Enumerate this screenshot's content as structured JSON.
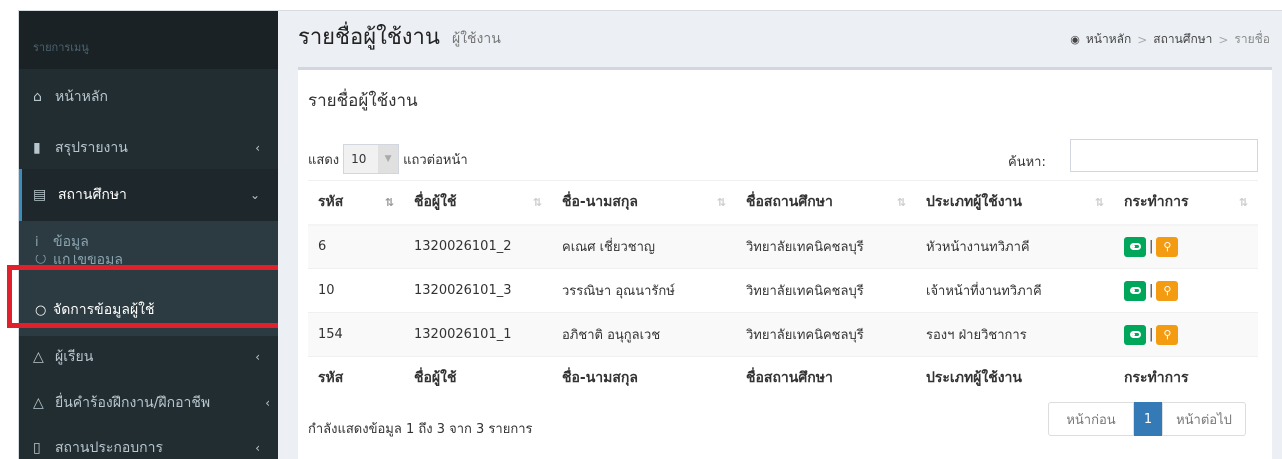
{
  "sidebar": {
    "header": "รายการเมนู",
    "items": [
      {
        "label": "หน้าหลัก",
        "icon": "home-icon"
      },
      {
        "label": "สรุปรายงาน",
        "icon": "book-icon"
      },
      {
        "label": "สถานศึกษา",
        "icon": "institution-icon"
      },
      {
        "label": "ผู้เรียน",
        "icon": "graduation-cap-icon"
      },
      {
        "label": "ยื่นคำร้องฝึกงาน/ฝึกอาชีพ",
        "icon": "graduation-cap-icon"
      },
      {
        "label": "สถานประกอบการ",
        "icon": "building-icon"
      }
    ],
    "sub_items": [
      {
        "label": "ข้อมูล"
      },
      {
        "label": "แก้ไขข้อมูล"
      },
      {
        "label": "จัดการข้อมูลผู้ใช้"
      }
    ]
  },
  "header": {
    "title": "รายชื่อผู้ใช้งาน",
    "subtitle": "ผู้ใช้งาน",
    "breadcrumb": [
      "หน้าหลัก",
      "สถานศึกษา",
      "รายชื่อ"
    ]
  },
  "box": {
    "title": "รายชื่อผู้ใช้งาน",
    "length_prefix": "แสดง",
    "length_value": "10",
    "length_suffix": "แถวต่อหน้า",
    "search_label": "ค้นหา:",
    "search_value": ""
  },
  "table": {
    "columns": [
      "รหัส",
      "ชื่อผู้ใช้",
      "ชื่อ-นามสกุล",
      "ชื่อสถานศึกษา",
      "ประเภทผู้ใช้งาน",
      "กระทำการ"
    ],
    "rows": [
      {
        "id": "6",
        "username": "1320026101_2",
        "fullname": "คเณศ เชี่ยวชาญ",
        "school": "วิทยาลัยเทคนิคชลบุรี",
        "role": "หัวหน้างานทวิภาคี"
      },
      {
        "id": "10",
        "username": "1320026101_3",
        "fullname": "วรรณิษา อุณนารักษ์",
        "school": "วิทยาลัยเทคนิคชลบุรี",
        "role": "เจ้าหน้าที่งานทวิภาคี"
      },
      {
        "id": "154",
        "username": "1320026101_1",
        "fullname": "อภิชาติ อนุกูลเวช",
        "school": "วิทยาลัยเทคนิคชลบุรี",
        "role": "รองฯ ฝ่ายวิชาการ"
      }
    ],
    "action_separator": "|"
  },
  "footer": {
    "info": "กำลังแสดงข้อมูล 1 ถึง 3 จาก 3 รายการ",
    "prev": "หน้าก่อน",
    "page": "1",
    "next": "หน้าต่อไป"
  },
  "colors": {
    "sidebar_bg": "#222d32",
    "accent": "#3c8dbc",
    "highlight": "#e0202a",
    "toggle_btn": "#00a65a",
    "key_btn": "#f39c12"
  }
}
